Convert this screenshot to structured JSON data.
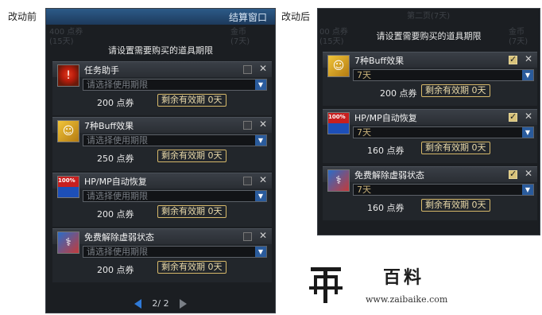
{
  "labels": {
    "before": "改动前",
    "after": "改动后"
  },
  "left": {
    "window_title": "结算窗口",
    "ghost": [
      "400 点券",
      "(15天)",
      "金币",
      "(7天)"
    ],
    "header": "请设置需要购买的道具期限",
    "items": [
      {
        "name": "任务助手",
        "select": "请选择使用期限",
        "price": "200 点券",
        "remaining": "剩余有效期 0天",
        "icon": "alert-icon"
      },
      {
        "name": "7种Buff效果",
        "select": "请选择使用期限",
        "price": "250 点券",
        "remaining": "剩余有效期 0天",
        "icon": "buff-icon"
      },
      {
        "name": "HP/MP自动恢复",
        "select": "请选择使用期限",
        "price": "200 点券",
        "remaining": "剩余有效期 0天",
        "icon": "hpmp-icon",
        "badge": "100%"
      },
      {
        "name": "免费解除虚弱状态",
        "select": "请选择使用期限",
        "price": "200 点券",
        "remaining": "剩余有效期 0天",
        "icon": "free-heal-icon"
      }
    ],
    "page": "2/ 2"
  },
  "right": {
    "ghost": [
      "第二页(7天)",
      "00 点券",
      "(15天)",
      "金币",
      "(7天)"
    ],
    "header": "请设置需要购买的道具期限",
    "items": [
      {
        "name": "7种Buff效果",
        "select": "7天",
        "price": "200 点券",
        "remaining": "剩余有效期 0天",
        "icon": "buff-icon"
      },
      {
        "name": "HP/MP自动恢复",
        "select": "7天",
        "price": "160 点券",
        "remaining": "剩余有效期 0天",
        "icon": "hpmp-icon",
        "badge": "100%"
      },
      {
        "name": "免费解除虚弱状态",
        "select": "7天",
        "price": "160 点券",
        "remaining": "剩余有效期 0天",
        "icon": "free-heal-icon"
      }
    ]
  },
  "watermark": {
    "brand": "百料",
    "url": "www.zaibaike.com"
  }
}
